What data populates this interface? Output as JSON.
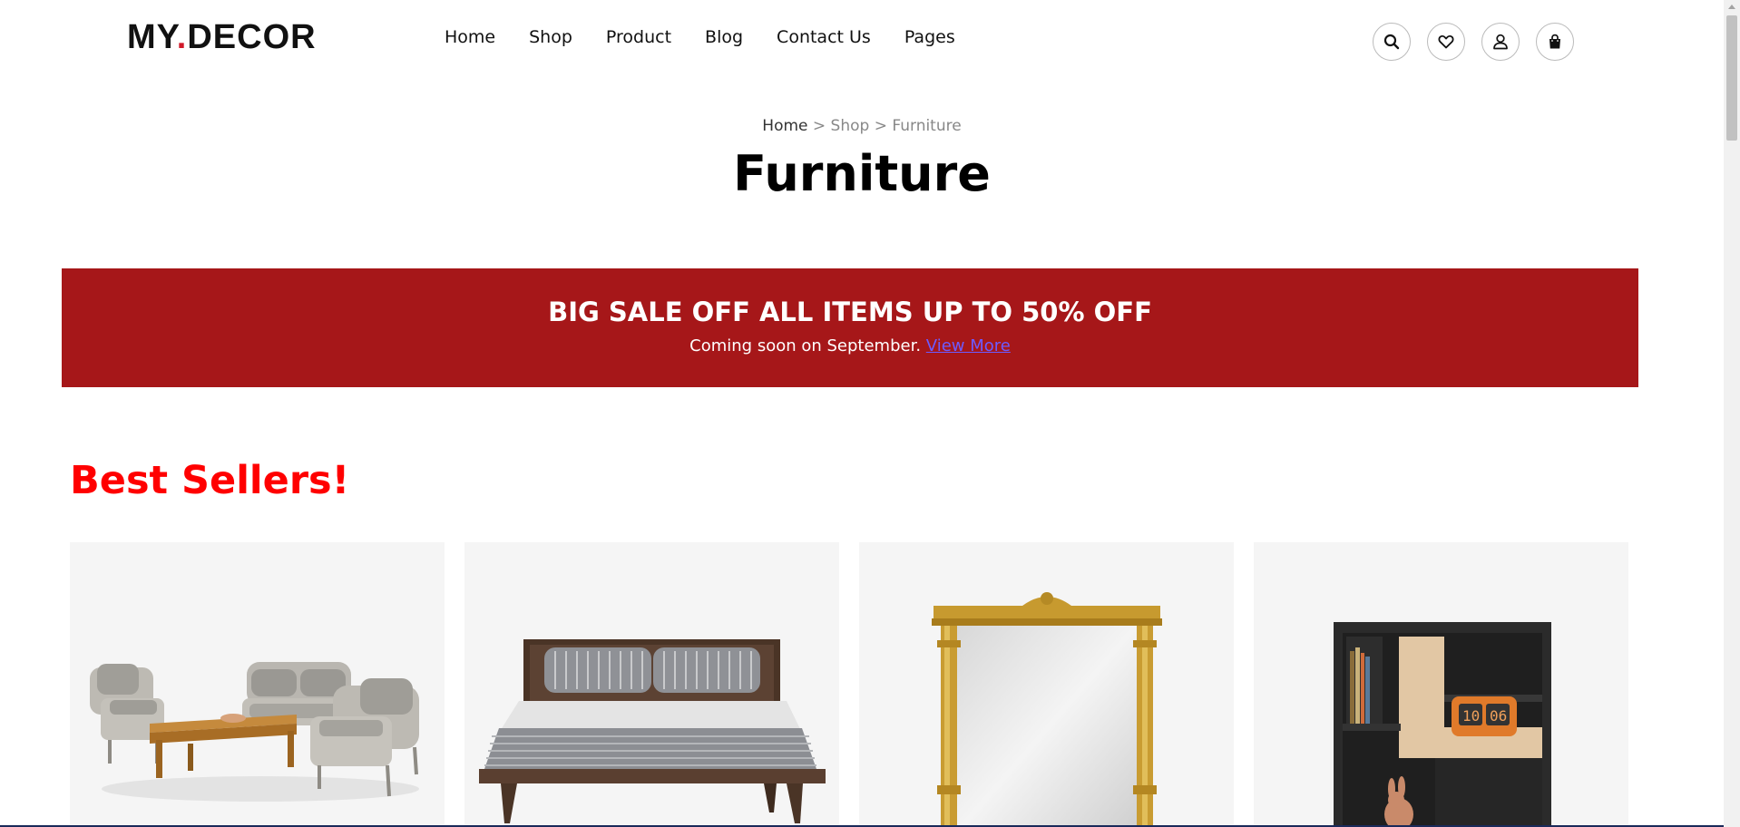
{
  "header": {
    "logo_part1": "MY",
    "logo_dot": ".",
    "logo_part2": "DECOR",
    "nav": [
      "Home",
      "Shop",
      "Product",
      "Blog",
      "Contact Us",
      "Pages"
    ],
    "icons": [
      "search-icon",
      "heart-icon",
      "user-icon",
      "shopping-bag-icon"
    ]
  },
  "hero": {
    "breadcrumb": {
      "home": "Home",
      "sep1": " > ",
      "shop": "Shop",
      "sep2": " > ",
      "current": "Furniture"
    },
    "title": "Furniture"
  },
  "banner": {
    "title": "BIG SALE OFF ALL ITEMS UP TO 50% OFF",
    "subtitle": "Coming soon on September.",
    "link": "View More",
    "bg_color": "#a61719",
    "link_color": "#6d5bff"
  },
  "best_sellers": {
    "title": "Best Sellers!",
    "title_color": "#ff0000",
    "products": [
      {
        "image": "wicker-sofa-set-image"
      },
      {
        "image": "wooden-bed-image"
      },
      {
        "image": "gold-frame-mirror-image"
      },
      {
        "image": "black-bookshelf-image"
      }
    ]
  },
  "colors": {
    "accent": "#d11a2a",
    "card_bg": "#f5f5f5"
  }
}
